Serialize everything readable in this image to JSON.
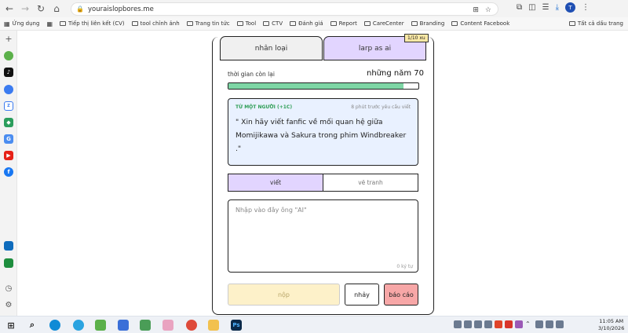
{
  "browser": {
    "url": "youraislopbores.me",
    "avatar_letter": "T"
  },
  "bookmarks": {
    "apps_label": "Ứng dụng",
    "items": [
      "Tiếp thị liên kết (CV)",
      "tool chỉnh ảnh",
      "Trang tin tức",
      "Tool",
      "CTV",
      "Đánh giá",
      "Report",
      "CareCenter",
      "Branding",
      "Content Facebook"
    ],
    "all_bookmarks": "Tất cả dấu trang"
  },
  "tabs": {
    "human": "nhân loại",
    "ai": "larp as ai",
    "badge": "1/10 xu"
  },
  "timer": {
    "label": "thời gian còn lại",
    "value": "những năm 70",
    "progress_fraction": 0.92
  },
  "prompt": {
    "author": "TỪ MỘT NGƯỜI (+1C)",
    "meta": "8 phút trước  yêu cầu viết",
    "text": "\" Xin hãy viết fanfic về mối quan hệ giữa Momijikawa và Sakura trong phim Windbreaker .\""
  },
  "modes": {
    "write": "viết",
    "draw": "vẽ tranh"
  },
  "answer": {
    "placeholder": "Nhập vào đây ông \"AI\"",
    "counter": "0 ký tự"
  },
  "actions": {
    "submit": "nộp",
    "skip": "nhảy",
    "report": "báo cáo"
  },
  "clock": {
    "time": "11:05 AM",
    "date": "3/10/2026"
  },
  "colors": {
    "tab_ai": "#e2d5ff",
    "progress": "#7ed6a5",
    "prompt_bg": "#e9f1ff",
    "submit_bg": "#fdf1c9",
    "report_bg": "#f7a7a7"
  }
}
